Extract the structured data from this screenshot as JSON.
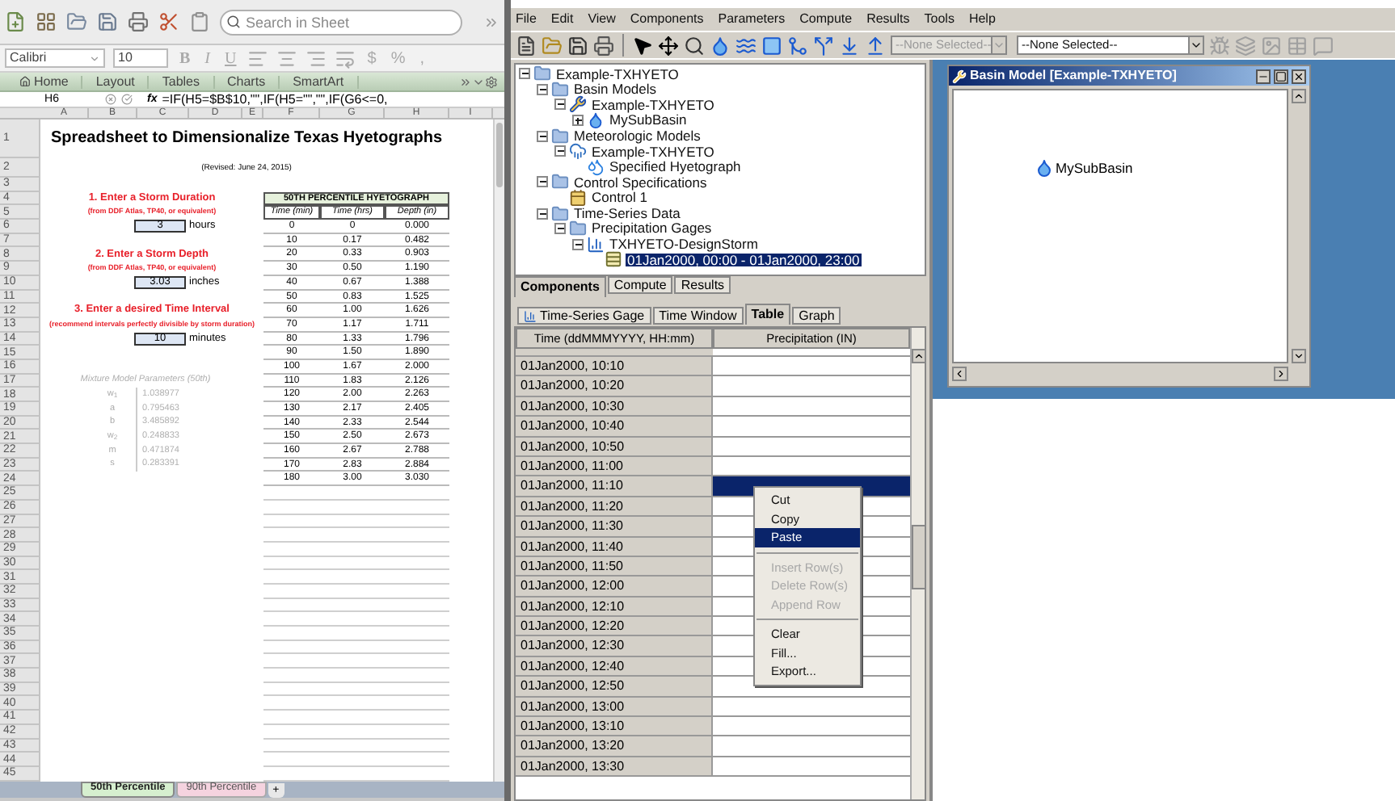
{
  "excel": {
    "search": {
      "placeholder": "Search in Sheet"
    },
    "font": {
      "name": "Calibri",
      "size": "10"
    },
    "format_buttons": [
      "B",
      "I",
      "U"
    ],
    "number_buttons": [
      "$",
      "%",
      ","
    ],
    "ribbon_tabs": [
      "Home",
      "Layout",
      "Tables",
      "Charts",
      "SmartArt"
    ],
    "formula_bar": {
      "cell": "H6",
      "fx": "fx",
      "formula": "=IF(H5=$B$10,\"\",IF(H5=\"\",\"\",IF(G6<=0,"
    },
    "columns": [
      "A",
      "B",
      "C",
      "D",
      "E",
      "F",
      "G",
      "H",
      "I"
    ],
    "rows": [
      {
        "n": "1",
        "left": {
          "kind": "title",
          "text": "Spreadsheet to Dimensionalize Texas Hyetographs"
        }
      },
      {
        "n": "2",
        "left": {
          "kind": "subtitle",
          "text": "(Revised: June 24, 2015)"
        }
      },
      {
        "n": "3"
      },
      {
        "n": "4",
        "left": {
          "kind": "step",
          "text": "1.  Enter a Storm Duration"
        },
        "right": {
          "kind": "table_title",
          "text": "50TH PERCENTILE HYETOGRAPH"
        }
      },
      {
        "n": "5",
        "left": {
          "kind": "note",
          "text": "(from DDF Atlas, TP40, or equivalent)"
        },
        "right": {
          "kind": "header",
          "cells": [
            "Time (min)",
            "Time (hrs)",
            "Depth (in)"
          ]
        }
      },
      {
        "n": "6",
        "left": {
          "kind": "input",
          "value": "3",
          "unit": "hours"
        },
        "right": {
          "kind": "data",
          "cells": [
            "0",
            "0",
            "0.000"
          ]
        }
      },
      {
        "n": "7",
        "right": {
          "kind": "data",
          "cells": [
            "10",
            "0.17",
            "0.482"
          ]
        }
      },
      {
        "n": "8",
        "left": {
          "kind": "step",
          "text": "2.  Enter a Storm Depth"
        },
        "right": {
          "kind": "data",
          "cells": [
            "20",
            "0.33",
            "0.903"
          ]
        }
      },
      {
        "n": "9",
        "left": {
          "kind": "note",
          "text": "(from DDF Atlas, TP40, or equivalent)"
        },
        "right": {
          "kind": "data",
          "cells": [
            "30",
            "0.50",
            "1.190"
          ]
        }
      },
      {
        "n": "10",
        "left": {
          "kind": "input",
          "value": "3.03",
          "unit": "inches"
        },
        "right": {
          "kind": "data",
          "cells": [
            "40",
            "0.67",
            "1.388"
          ]
        }
      },
      {
        "n": "11",
        "right": {
          "kind": "data",
          "cells": [
            "50",
            "0.83",
            "1.525"
          ]
        }
      },
      {
        "n": "12",
        "left": {
          "kind": "step",
          "text": "3. Enter a desired Time Interval"
        },
        "right": {
          "kind": "data",
          "cells": [
            "60",
            "1.00",
            "1.626"
          ]
        }
      },
      {
        "n": "13",
        "left": {
          "kind": "note",
          "text": "(recommend intervals perfectly divisible by storm duration)"
        },
        "right": {
          "kind": "data",
          "cells": [
            "70",
            "1.17",
            "1.711"
          ]
        }
      },
      {
        "n": "14",
        "left": {
          "kind": "input",
          "value": "10",
          "unit": "minutes"
        },
        "right": {
          "kind": "data",
          "cells": [
            "80",
            "1.33",
            "1.796"
          ]
        }
      },
      {
        "n": "15",
        "right": {
          "kind": "data",
          "cells": [
            "90",
            "1.50",
            "1.890"
          ]
        }
      },
      {
        "n": "16",
        "right": {
          "kind": "data",
          "cells": [
            "100",
            "1.67",
            "2.000"
          ]
        }
      },
      {
        "n": "17",
        "left": {
          "kind": "params_title",
          "text": "Mixture Model Parameters (50th)"
        },
        "right": {
          "kind": "data",
          "cells": [
            "110",
            "1.83",
            "2.126"
          ]
        }
      },
      {
        "n": "18",
        "left": {
          "kind": "param",
          "name": "w$_{1}$",
          "value": "1.038977"
        },
        "right": {
          "kind": "data",
          "cells": [
            "120",
            "2.00",
            "2.263"
          ]
        }
      },
      {
        "n": "19",
        "left": {
          "kind": "param",
          "name": "a",
          "value": "0.795463"
        },
        "right": {
          "kind": "data",
          "cells": [
            "130",
            "2.17",
            "2.405"
          ]
        }
      },
      {
        "n": "20",
        "left": {
          "kind": "param",
          "name": "b",
          "value": "3.485892"
        },
        "right": {
          "kind": "data",
          "cells": [
            "140",
            "2.33",
            "2.544"
          ]
        }
      },
      {
        "n": "21",
        "left": {
          "kind": "param",
          "name": "w$_{2}$",
          "value": "0.248833"
        },
        "right": {
          "kind": "data",
          "cells": [
            "150",
            "2.50",
            "2.673"
          ]
        }
      },
      {
        "n": "22",
        "left": {
          "kind": "param",
          "name": "m",
          "value": "0.471874"
        },
        "right": {
          "kind": "data",
          "cells": [
            "160",
            "2.67",
            "2.788"
          ]
        }
      },
      {
        "n": "23",
        "left": {
          "kind": "param",
          "name": "s",
          "value": "0.283391"
        },
        "right": {
          "kind": "data",
          "cells": [
            "170",
            "2.83",
            "2.884"
          ]
        }
      },
      {
        "n": "24",
        "right": {
          "kind": "data",
          "cells": [
            "180",
            "3.00",
            "3.030"
          ]
        }
      },
      {
        "n": "25",
        "right": {
          "kind": "empty"
        }
      },
      {
        "n": "26",
        "right": {
          "kind": "empty"
        }
      },
      {
        "n": "27",
        "right": {
          "kind": "empty"
        }
      },
      {
        "n": "28",
        "right": {
          "kind": "empty"
        }
      },
      {
        "n": "29",
        "right": {
          "kind": "empty"
        }
      },
      {
        "n": "30",
        "right": {
          "kind": "empty"
        }
      },
      {
        "n": "31",
        "right": {
          "kind": "empty"
        }
      },
      {
        "n": "32",
        "right": {
          "kind": "empty"
        }
      },
      {
        "n": "33",
        "right": {
          "kind": "empty"
        }
      },
      {
        "n": "34",
        "right": {
          "kind": "empty"
        }
      },
      {
        "n": "35",
        "right": {
          "kind": "empty"
        }
      },
      {
        "n": "36",
        "right": {
          "kind": "empty"
        }
      },
      {
        "n": "37",
        "right": {
          "kind": "empty"
        }
      },
      {
        "n": "38",
        "right": {
          "kind": "empty"
        }
      },
      {
        "n": "39",
        "right": {
          "kind": "empty"
        }
      },
      {
        "n": "40",
        "right": {
          "kind": "empty"
        }
      },
      {
        "n": "41",
        "right": {
          "kind": "empty"
        }
      },
      {
        "n": "42",
        "right": {
          "kind": "empty"
        }
      },
      {
        "n": "43",
        "right": {
          "kind": "empty"
        }
      },
      {
        "n": "44",
        "right": {
          "kind": "empty"
        }
      },
      {
        "n": "45",
        "right": {
          "kind": "empty"
        }
      }
    ],
    "sheet_tabs": [
      {
        "label": "50th Percentile",
        "selected": true,
        "color": "#d6efcf"
      },
      {
        "label": "90th Percentile",
        "selected": false,
        "color": "#f5d3df"
      }
    ],
    "add_sheet": "+"
  },
  "hms": {
    "menu": [
      "File",
      "Edit",
      "View",
      "Components",
      "Parameters",
      "Compute",
      "Results",
      "Tools",
      "Help"
    ],
    "dropdowns": [
      {
        "value": "--None Selected--",
        "disabled": true
      },
      {
        "value": "--None Selected--",
        "disabled": false
      }
    ],
    "tree": [
      {
        "label": "Example-TXHYETO",
        "kind": "folder",
        "selected": false,
        "expanded": true,
        "children": [
          {
            "label": "Basin Models",
            "kind": "folder",
            "selected": false,
            "expanded": true,
            "children": [
              {
                "label": "Example-TXHYETO",
                "kind": "basin",
                "selected": false,
                "expanded": true,
                "children": [
                  {
                    "label": "MySubBasin",
                    "kind": "subbasin",
                    "selected": false,
                    "expanded": false
                  }
                ]
              }
            ]
          },
          {
            "label": "Meteorologic Models",
            "kind": "folder",
            "selected": false,
            "expanded": true,
            "children": [
              {
                "label": "Example-TXHYETO",
                "kind": "met",
                "selected": false,
                "expanded": true,
                "children": [
                  {
                    "label": "Specified Hyetograph",
                    "kind": "hyetograph",
                    "selected": false
                  }
                ]
              }
            ]
          },
          {
            "label": "Control Specifications",
            "kind": "folder",
            "selected": false,
            "expanded": true,
            "children": [
              {
                "label": "Control 1",
                "kind": "control",
                "selected": false
              }
            ]
          },
          {
            "label": "Time-Series Data",
            "kind": "folder",
            "selected": false,
            "expanded": true,
            "children": [
              {
                "label": "Precipitation Gages",
                "kind": "folder",
                "selected": false,
                "expanded": true,
                "children": [
                  {
                    "label": "TXHYETO-DesignStorm",
                    "kind": "gage",
                    "selected": false,
                    "expanded": true,
                    "children": [
                      {
                        "label": "01Jan2000, 00:00 - 01Jan2000, 23:00",
                        "kind": "series",
                        "selected": true
                      }
                    ]
                  }
                ]
              }
            ]
          }
        ]
      }
    ],
    "tree_tabs": [
      {
        "label": "Components",
        "selected": true
      },
      {
        "label": "Compute",
        "selected": false
      },
      {
        "label": "Results",
        "selected": false
      }
    ],
    "editor_tabs": [
      {
        "label": "Time-Series Gage",
        "selected": false
      },
      {
        "label": "Time Window",
        "selected": false
      },
      {
        "label": "Table",
        "selected": true
      },
      {
        "label": "Graph",
        "selected": false
      }
    ],
    "table": {
      "columns": [
        "Time (ddMMMYYYY, HH:mm)",
        "Precipitation (IN)"
      ],
      "rows": [
        {
          "time": "01Jan2000, 10:10",
          "selected": false
        },
        {
          "time": "01Jan2000, 10:20",
          "selected": false
        },
        {
          "time": "01Jan2000, 10:30",
          "selected": false
        },
        {
          "time": "01Jan2000, 10:40",
          "selected": false
        },
        {
          "time": "01Jan2000, 10:50",
          "selected": false
        },
        {
          "time": "01Jan2000, 11:00",
          "selected": false
        },
        {
          "time": "01Jan2000, 11:10",
          "selected": true
        },
        {
          "time": "01Jan2000, 11:20",
          "selected": false
        },
        {
          "time": "01Jan2000, 11:30",
          "selected": false
        },
        {
          "time": "01Jan2000, 11:40",
          "selected": false
        },
        {
          "time": "01Jan2000, 11:50",
          "selected": false
        },
        {
          "time": "01Jan2000, 12:00",
          "selected": false
        },
        {
          "time": "01Jan2000, 12:10",
          "selected": false
        },
        {
          "time": "01Jan2000, 12:20",
          "selected": false
        },
        {
          "time": "01Jan2000, 12:30",
          "selected": false
        },
        {
          "time": "01Jan2000, 12:40",
          "selected": false
        },
        {
          "time": "01Jan2000, 12:50",
          "selected": false
        },
        {
          "time": "01Jan2000, 13:00",
          "selected": false
        },
        {
          "time": "01Jan2000, 13:10",
          "selected": false
        },
        {
          "time": "01Jan2000, 13:20",
          "selected": false
        },
        {
          "time": "01Jan2000, 13:30",
          "selected": false
        }
      ]
    },
    "context_menu": [
      {
        "kind": "item",
        "label": "Cut",
        "selected": false,
        "disabled": false
      },
      {
        "kind": "item",
        "label": "Copy",
        "selected": false,
        "disabled": false
      },
      {
        "kind": "item",
        "label": "Paste",
        "selected": true,
        "disabled": false
      },
      {
        "kind": "separator"
      },
      {
        "kind": "item",
        "label": "Insert Row(s)",
        "selected": false,
        "disabled": true
      },
      {
        "kind": "item",
        "label": "Delete Row(s)",
        "selected": false,
        "disabled": true
      },
      {
        "kind": "item",
        "label": "Append Row",
        "selected": false,
        "disabled": true
      },
      {
        "kind": "separator"
      },
      {
        "kind": "item",
        "label": "Clear",
        "selected": false,
        "disabled": false
      },
      {
        "kind": "item",
        "label": "Fill...",
        "selected": false,
        "disabled": false
      },
      {
        "kind": "item",
        "label": "Export...",
        "selected": false,
        "disabled": false
      }
    ],
    "basin_window": {
      "title": "Basin Model [Example-TXHYETO]",
      "element": "MySubBasin"
    }
  }
}
